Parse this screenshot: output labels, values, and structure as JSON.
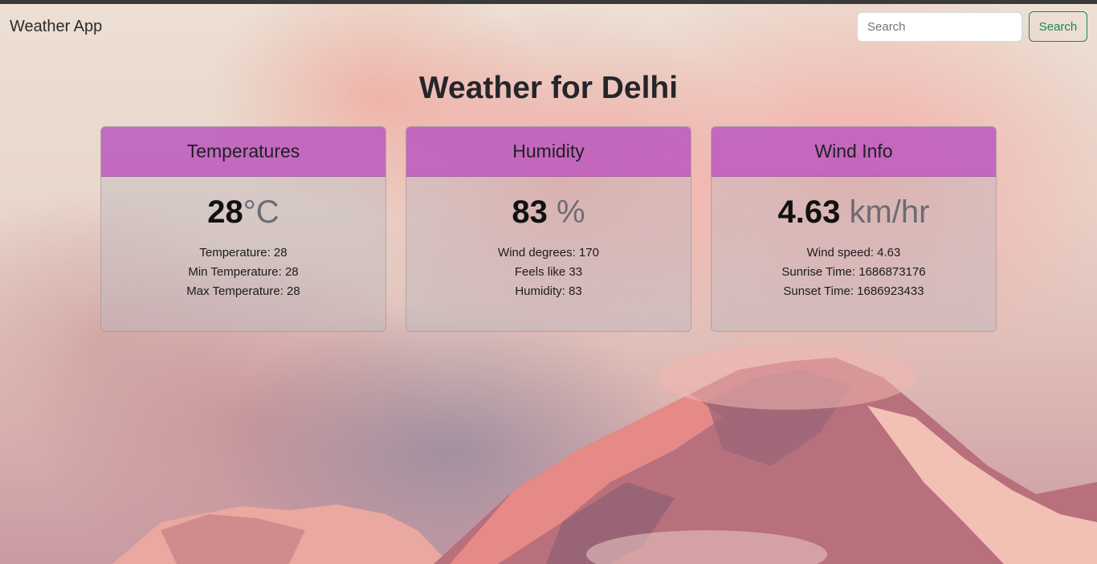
{
  "navbar": {
    "brand": "Weather App",
    "search_placeholder": "Search",
    "search_button": "Search"
  },
  "page": {
    "title": "Weather for Delhi"
  },
  "cards": [
    {
      "header": "Temperatures",
      "value": "28",
      "unit": "°C",
      "details": [
        "Temperature: 28",
        "Min Temperature: 28",
        "Max Temperature: 28"
      ]
    },
    {
      "header": "Humidity",
      "value": "83",
      "unit": " %",
      "details": [
        "Wind degrees: 170",
        "Feels like 33",
        "Humidity: 83"
      ]
    },
    {
      "header": "Wind Info",
      "value": "4.63",
      "unit": " km/hr",
      "details": [
        "Wind speed: 4.63",
        "Sunrise Time: 1686873176",
        "Sunset Time: 1686923433"
      ]
    }
  ],
  "colors": {
    "card_header": "#be55be",
    "search_button": "#198754"
  }
}
